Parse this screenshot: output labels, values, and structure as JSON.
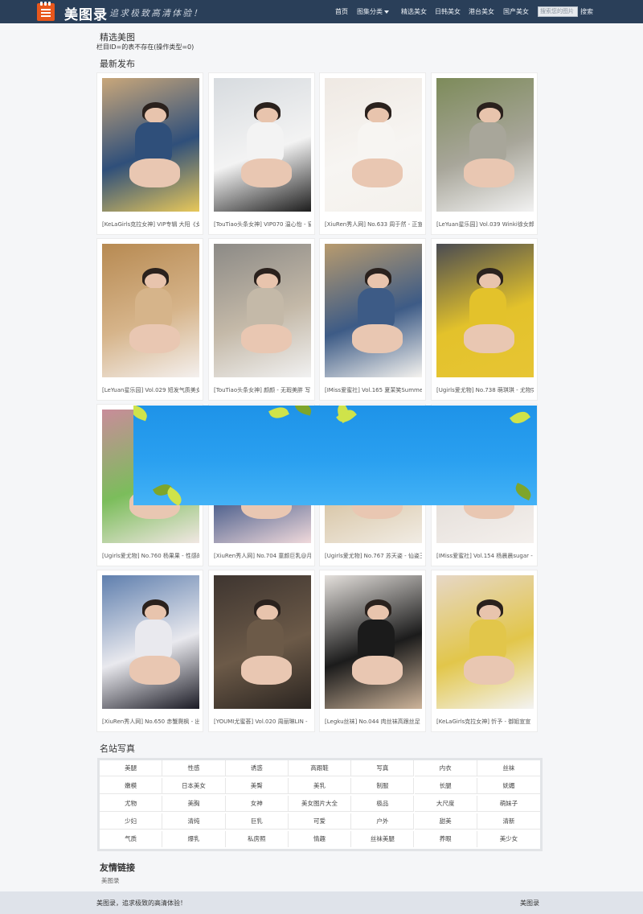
{
  "header": {
    "brand": "美图录",
    "slogan": "追求极致高清体验！",
    "nav": [
      "首页",
      "图集分类",
      "精选美女",
      "日韩美女",
      "港台美女",
      "国产美女"
    ],
    "search_placeholder": "搜索您的图片",
    "search_button": "搜索"
  },
  "featured": {
    "title": "精选美图",
    "error_note": "栏目ID=的表不存在(操作类型=0)"
  },
  "latest": {
    "title": "最新发布",
    "items": [
      {
        "caption": "[KeLaGirls克拉女神] VIP专辑 大阳《女",
        "colors": [
          "#c9a77a",
          "#2f4f7a",
          "#e8c85a"
        ]
      },
      {
        "caption": "[TouTiao头条女神] VIP070 温心怡 - 窗",
        "colors": [
          "#d7dbdf",
          "#f3f3f3",
          "#1d1d1d"
        ]
      },
      {
        "caption": "[XiuRen秀人网] No.633 周于然 - 正宣",
        "colors": [
          "#efe9e3",
          "#f7f5f2",
          "#f4f1ec"
        ]
      },
      {
        "caption": "[LeYuan星乐园] Vol.039 Winki徐女郎",
        "colors": [
          "#7d8b5a",
          "#a8a69a",
          "#f2f2f2"
        ]
      },
      {
        "caption": "[LeYuan星乐园] Vol.029 短发气质美女",
        "colors": [
          "#b78a52",
          "#d6b48a",
          "#f4f0ee"
        ]
      },
      {
        "caption": "[TouTiao头条女神] 颜颜 - 无瑕美胖 写",
        "colors": [
          "#8c8a86",
          "#c4b9a8",
          "#f1f1f1"
        ]
      },
      {
        "caption": "[IMiss爱蜜社] Vol.165 夏茉笑Summer",
        "colors": [
          "#b89b6e",
          "#3d5b86",
          "#f5f3ef"
        ]
      },
      {
        "caption": "[Ugirls爱尤物] No.738 萌琪琪 - 尤物突",
        "colors": [
          "#4a4b52",
          "#e3c22b",
          "#e7c534"
        ]
      },
      {
        "caption": "[Ugirls爱尤物] No.760 杨果果 - 性感的",
        "colors": [
          "#c98c9a",
          "#7bbd5b",
          "#f1e7e3"
        ]
      },
      {
        "caption": "[XiuRen秀人网] No.704 童颜巨乳@月",
        "colors": [
          "#d9d4d6",
          "#4c5f8c",
          "#f0d9db"
        ]
      },
      {
        "caption": "[Ugirls爱尤物] No.767 苏天姿 - 仙姿玉",
        "colors": [
          "#9a7a4e",
          "#d9c7a8",
          "#f1ece4"
        ]
      },
      {
        "caption": "[IMiss爱蜜社] Vol.154 杨晨晨sugar -",
        "colors": [
          "#cfc7c1",
          "#e6e0db",
          "#f4f0ed"
        ]
      },
      {
        "caption": "[XiuRen秀人网] No.650 赤蟹爬枫 - 出",
        "colors": [
          "#5f7fae",
          "#e9e9ee",
          "#1a1a24"
        ]
      },
      {
        "caption": "[YOUMI尤蜜荟] Vol.020 周丽琳LIN -",
        "colors": [
          "#3e3530",
          "#6c5a48",
          "#2a2420"
        ]
      },
      {
        "caption": "[Legku丝袜] No.044 肉丝袜高跟丝足",
        "colors": [
          "#e4e0dc",
          "#1b1b1b",
          "#cdb49a"
        ]
      },
      {
        "caption": "[KeLaGirls克拉女神] 忻予 - 御姐宣宣",
        "colors": [
          "#e6d7c6",
          "#e2c64a",
          "#f3f3f3"
        ]
      }
    ]
  },
  "tags_section": {
    "title": "名站写真",
    "rows": [
      [
        "美腿",
        "性感",
        "诱惑",
        "高跟鞋",
        "写真",
        "内衣",
        "丝袜"
      ],
      [
        "嫩模",
        "日本美女",
        "美臀",
        "美乳",
        "制服",
        "长腿",
        "妩媚"
      ],
      [
        "尤物",
        "美胸",
        "女神",
        "美女图片大全",
        "极品",
        "大尺度",
        "萌妹子"
      ],
      [
        "少妇",
        "清纯",
        "巨乳",
        "可爱",
        "户外",
        "甜美",
        "清新"
      ],
      [
        "气质",
        "爆乳",
        "私房照",
        "情趣",
        "丝袜美腿",
        "养眼",
        "美少女"
      ]
    ]
  },
  "friend_links": {
    "title": "友情链接",
    "items": [
      "美图录"
    ]
  },
  "footer": {
    "left": "美图录，追求极致的高清体验！",
    "right": "美图录"
  }
}
